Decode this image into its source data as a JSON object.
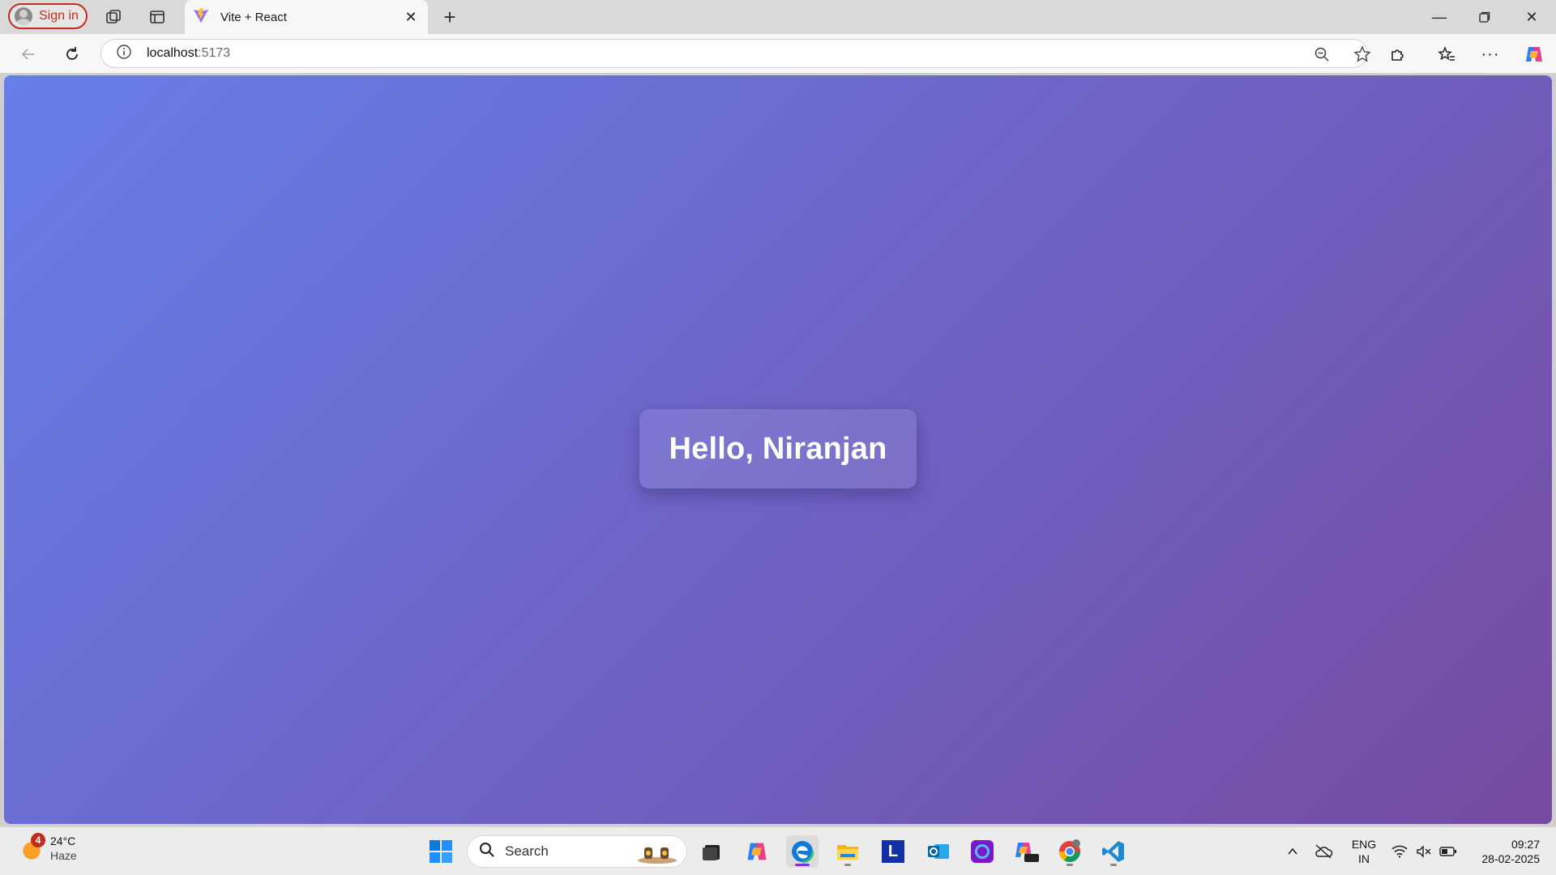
{
  "browser": {
    "signin_label": "Sign in",
    "tab": {
      "title": "Vite + React",
      "favicon": "vite-icon"
    },
    "address": {
      "host": "localhost",
      "port": ":5173"
    },
    "colors": {
      "accent_red": "#c42b1c",
      "tab_bg": "#f7f7f7",
      "strip_bg": "#d9d9d9"
    }
  },
  "page": {
    "greeting": "Hello, Niranjan",
    "gradient": {
      "from": "#667eea",
      "to": "#764ba2"
    }
  },
  "taskbar": {
    "weather": {
      "badge": "4",
      "temp": "24°C",
      "condition": "Haze"
    },
    "search": {
      "label": "Search"
    },
    "apps": [
      "windows-start-icon",
      "search-icon",
      "task-view-icon",
      "copilot-icon",
      "edge-icon",
      "file-explorer-icon",
      "l-app-icon",
      "outlook-icon",
      "circle-app-icon",
      "m365-icon",
      "chrome-icon",
      "vscode-icon"
    ],
    "tray": {
      "lang_top": "ENG",
      "lang_bottom": "IN",
      "time": "09:27",
      "date": "28-02-2025"
    }
  }
}
